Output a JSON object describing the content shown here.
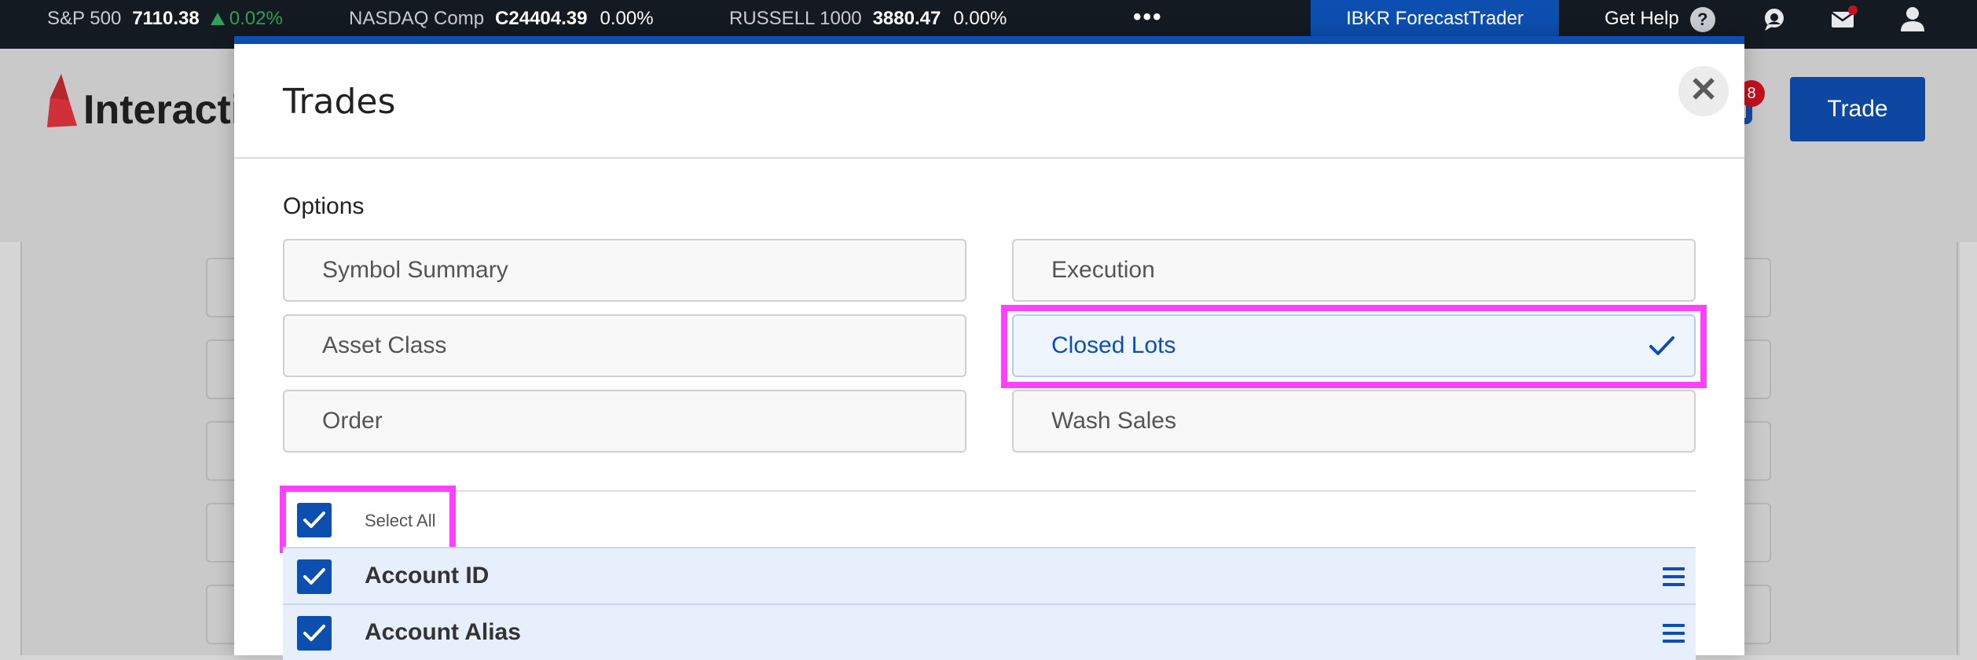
{
  "ticker": {
    "items": [
      {
        "name": "S&P 500",
        "value": "7110.38",
        "change": "0.02%",
        "direction": "up"
      },
      {
        "name": "NASDAQ Comp",
        "value": "C24404.39",
        "change": "0.00%",
        "direction": "flat"
      },
      {
        "name": "RUSSELL 1000",
        "value": "3880.47",
        "change": "0.00%",
        "direction": "flat"
      }
    ],
    "more_label": "•••",
    "forecast_trader": "IBKR ForecastTrader",
    "get_help": "Get Help",
    "help_glyph": "?"
  },
  "header": {
    "logo_text": "Interacti",
    "notification_count": "8",
    "trade_button": "Trade"
  },
  "modal": {
    "title": "Trades",
    "close_glyph": "✕",
    "options_heading": "Options",
    "options": [
      {
        "label": "Symbol Summary",
        "selected": false
      },
      {
        "label": "Execution",
        "selected": false
      },
      {
        "label": "Asset Class",
        "selected": false
      },
      {
        "label": "Closed Lots",
        "selected": true
      },
      {
        "label": "Order",
        "selected": false
      },
      {
        "label": "Wash Sales",
        "selected": false
      }
    ],
    "select_all_label": "Select All",
    "select_all_checked": true,
    "fields": [
      {
        "label": "Account ID",
        "checked": true
      },
      {
        "label": "Account Alias",
        "checked": true
      }
    ]
  },
  "colors": {
    "accent": "#0d4fb0",
    "highlight": "#ff40ff",
    "ticker_bg": "#141a22",
    "positive": "#2f9f5a"
  },
  "icons": [
    "chat-icon",
    "mail-icon",
    "user-icon",
    "close-icon",
    "checkmark-icon",
    "drag-handle-icon",
    "bell-icon"
  ]
}
